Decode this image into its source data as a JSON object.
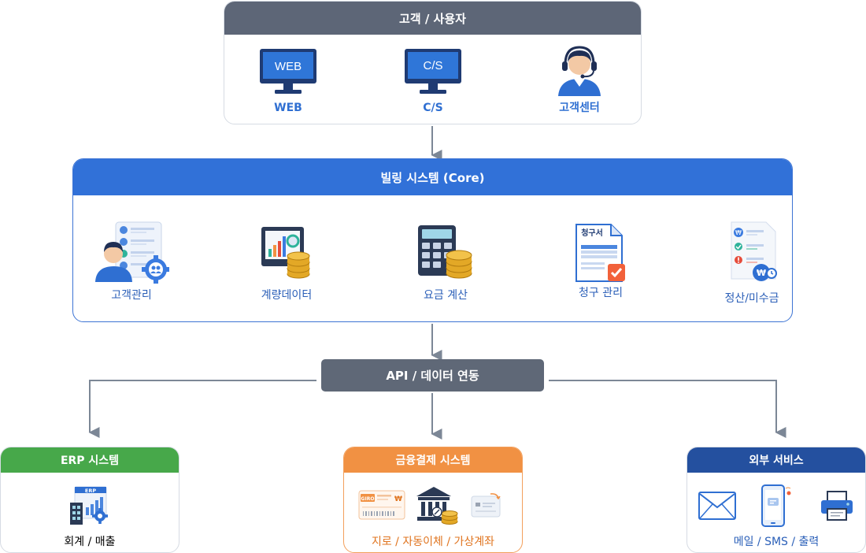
{
  "colors": {
    "users_header": "#5d6677",
    "billing_header": "#3171d8",
    "api_box": "#5f6877",
    "erp_header": "#47a84a",
    "payment_header": "#f19143",
    "external_header": "#24509f",
    "connector": "#7c8796"
  },
  "users": {
    "title": "고객 / 사용자",
    "items": [
      {
        "label": "WEB",
        "screen_text": "WEB",
        "icon": "monitor-icon"
      },
      {
        "label": "C/S",
        "screen_text": "C/S",
        "icon": "monitor-icon"
      },
      {
        "label": "고객센터",
        "icon": "headset-agent-icon"
      }
    ]
  },
  "billing": {
    "title": "빌링 시스템 (Core)",
    "items": [
      {
        "label": "고객관리",
        "icon": "customer-management-icon"
      },
      {
        "label": "계량데이터",
        "icon": "metering-data-icon"
      },
      {
        "label": "요금 계산",
        "icon": "calculator-icon"
      },
      {
        "label": "청구 관리",
        "icon": "invoice-icon",
        "doc_title": "청구서"
      },
      {
        "label": "정산/미수금",
        "icon": "settlement-icon"
      }
    ]
  },
  "api": {
    "label": "API / 데이터 연동"
  },
  "erp": {
    "title": "ERP 시스템",
    "badge": "ERP",
    "footer": "회계 / 매출",
    "icon": "erp-building-icon"
  },
  "payment": {
    "title": "금융결제 시스템",
    "giro_badge": "GIRO",
    "footer": "지로 / 자동이체 / 가상계좌",
    "icons": [
      "giro-bill-icon",
      "bank-icon",
      "virtual-account-icon"
    ]
  },
  "external": {
    "title": "외부 서비스",
    "footer": "메일 / SMS / 출력",
    "icons": [
      "mail-icon",
      "smartphone-icon",
      "printer-icon"
    ]
  }
}
